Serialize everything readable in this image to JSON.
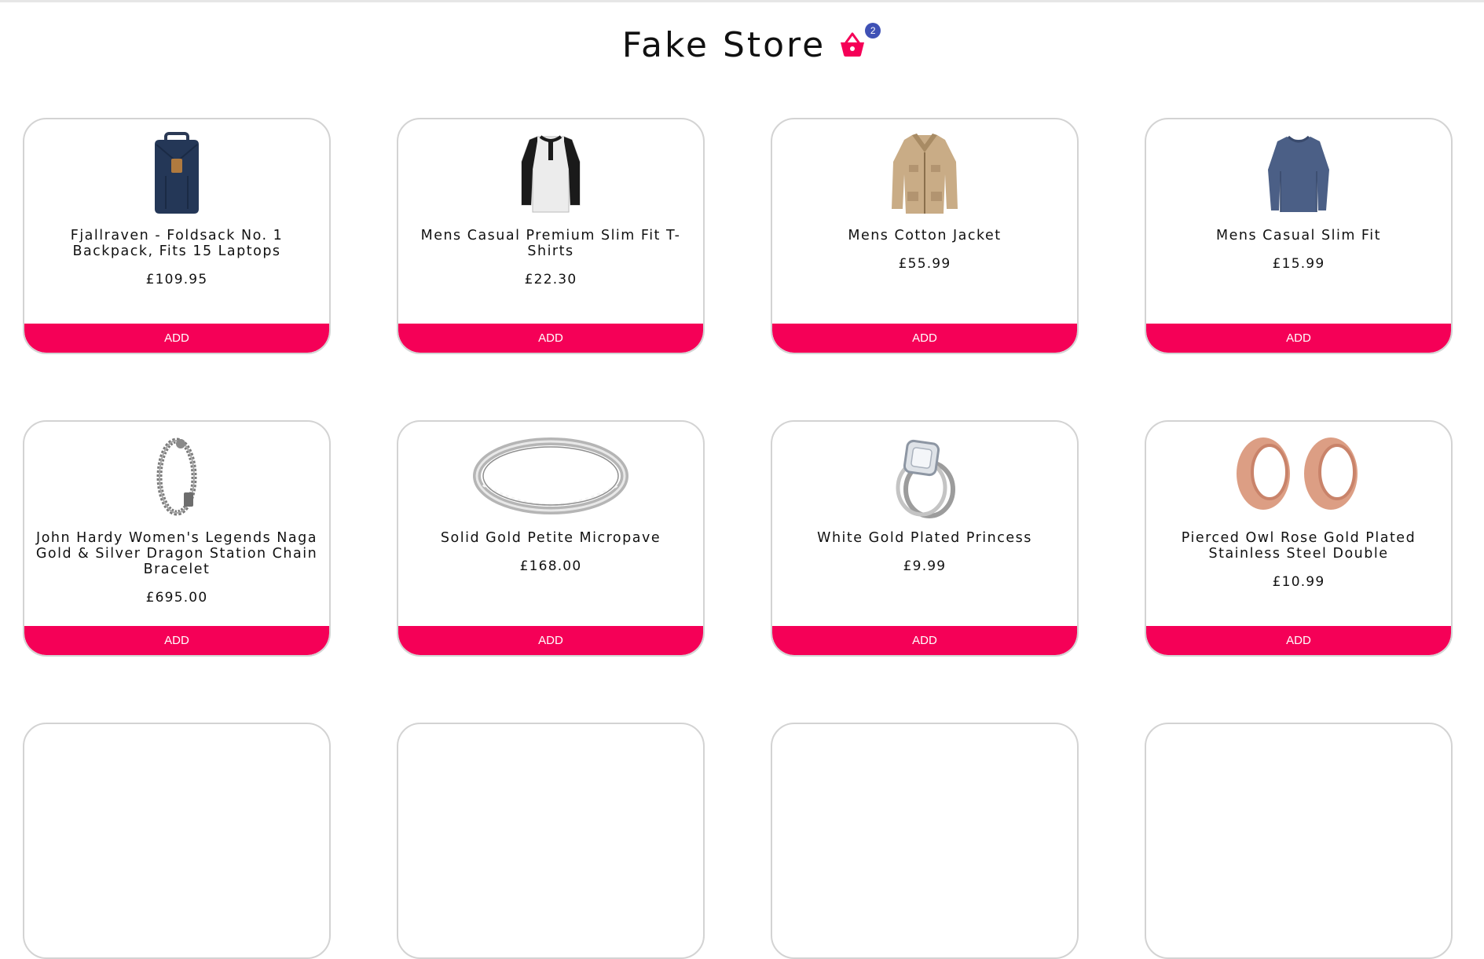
{
  "header": {
    "title": "Fake Store",
    "cart_count": "2",
    "cart_icon": "shopping-basket-icon",
    "accent_color": "#f50057",
    "badge_color": "#3f51b5"
  },
  "products": [
    {
      "name": "Fjallraven - Foldsack No. 1 Backpack, Fits 15 Laptops",
      "price": "£109.95",
      "button": "ADD",
      "icon": "backpack-icon"
    },
    {
      "name": "Mens Casual Premium Slim Fit T-Shirts",
      "price": "£22.30",
      "button": "ADD",
      "icon": "tshirt-icon"
    },
    {
      "name": "Mens Cotton Jacket",
      "price": "£55.99",
      "button": "ADD",
      "icon": "jacket-icon"
    },
    {
      "name": "Mens Casual Slim Fit",
      "price": "£15.99",
      "button": "ADD",
      "icon": "long-sleeve-shirt-icon"
    },
    {
      "name": "John Hardy Women's Legends Naga Gold & Silver Dragon Station Chain Bracelet",
      "price": "£695.00",
      "button": "ADD",
      "icon": "bracelet-icon"
    },
    {
      "name": "Solid Gold Petite Micropave",
      "price": "£168.00",
      "button": "ADD",
      "icon": "ring-icon"
    },
    {
      "name": "White Gold Plated Princess",
      "price": "£9.99",
      "button": "ADD",
      "icon": "diamond-ring-icon"
    },
    {
      "name": "Pierced Owl Rose Gold Plated Stainless Steel Double",
      "price": "£10.99",
      "button": "ADD",
      "icon": "ear-tunnel-icon"
    }
  ]
}
